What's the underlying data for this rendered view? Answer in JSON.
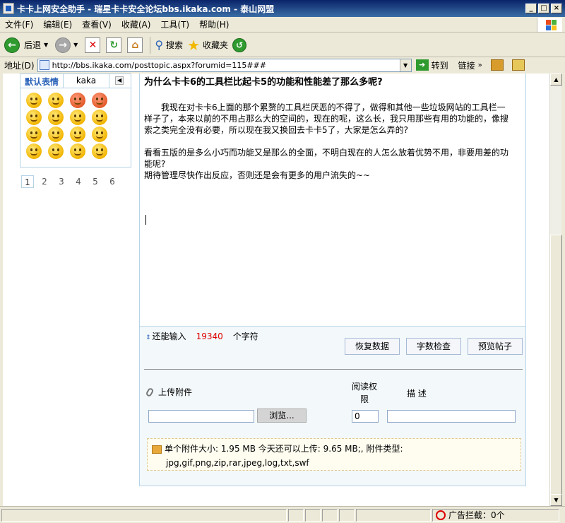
{
  "window": {
    "title": "卡卡上网安全助手 - 瑞星卡卡安全论坛bbs.ikaka.com - 泰山网盟",
    "minimize": "_",
    "maximize": "□",
    "close": "×"
  },
  "menu": [
    "文件(F)",
    "编辑(E)",
    "查看(V)",
    "收藏(A)",
    "工具(T)",
    "帮助(H)"
  ],
  "toolbar": {
    "back_label": "后退",
    "search_label": "搜索",
    "favorites_label": "收藏夹"
  },
  "address": {
    "label": "地址(D)",
    "url": "http://bbs.ikaka.com/posttopic.aspx?forumid=115###",
    "go_label": "转到",
    "links_label": "链接"
  },
  "smiley_panel": {
    "tab_default": "默认表情",
    "tab_kaka": "kaka",
    "pages": [
      "1",
      "2",
      "3",
      "4",
      "5",
      "6"
    ],
    "current_page": "1"
  },
  "post": {
    "title": "为什么卡卡6的工具栏比起卡5的功能和性能差了那么多呢?",
    "para1": "我现在对卡卡6上面的那个累赘的工具栏厌恶的不得了，做得和其他一些垃圾网站的工具栏一样子了，本来以前的不用占那么大的空间的，现在的呢，这么长，我只用那些有用的功能的，像搜索之类完全没有必要，所以现在我又换回去卡卡5了，大家是怎么弄的?",
    "para2": "看看五版的是多么小巧而功能又是那么的全面，不明白现在的人怎么放着优势不用，非要用差的功能呢?",
    "para3": "期待管理尽快作出反应，否则还是会有更多的用户流失的~~"
  },
  "editor_footer": {
    "remain_prefix": "还能输入",
    "remain_count": "19340",
    "remain_suffix": "个字符",
    "restore_button": "恢复数据",
    "check_button": "字数检查",
    "preview_button": "预览帖子"
  },
  "attachment": {
    "upload_label": "上传附件",
    "permission_label": "阅读权限",
    "description_label": "描 述",
    "browse_button": "浏览...",
    "permission_value": "0",
    "info_line1": "单个附件大小: 1.95 MB  今天还可以上传: 9.65 MB;,  附件类型:",
    "info_line2": "jpg,gif,png,zip,rar,jpeg,log,txt,swf"
  },
  "statusbar": {
    "popup_blocker": "广告拦截：0个"
  },
  "colors": {
    "accent": "#2a62b8",
    "count_red": "#dd0000",
    "panel_border": "#b5d3e6"
  }
}
